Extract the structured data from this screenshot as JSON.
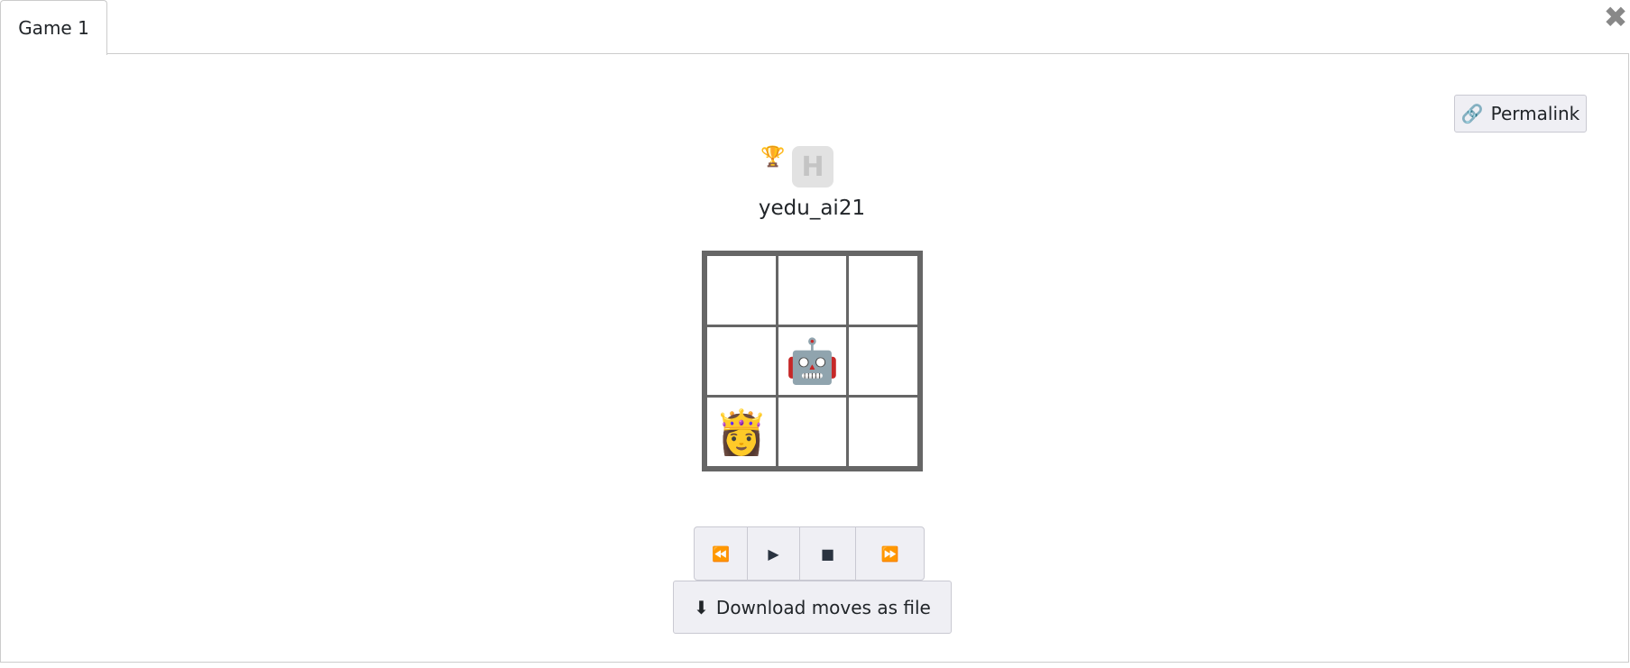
{
  "tabs": [
    {
      "label": "Game 1",
      "active": true
    }
  ],
  "close_icon": "close-icon",
  "permalink": {
    "label": "Permalink",
    "icon": "link-icon"
  },
  "player": {
    "name": "yedu_ai21",
    "badges": [
      "trophy-icon",
      "h-icon"
    ],
    "h_letter": "H"
  },
  "board": {
    "rows": 3,
    "cols": 3,
    "cells": [
      [
        "",
        "",
        ""
      ],
      [
        "",
        "robot",
        ""
      ],
      [
        "queen",
        "",
        ""
      ]
    ],
    "glyphs": {
      "robot": "🤖",
      "queen": "👸"
    }
  },
  "controls": {
    "rewind": "⏪",
    "play": "▶",
    "stop": "■",
    "fast_forward": "⏩"
  },
  "download": {
    "label": "Download moves as file",
    "icon": "download-icon"
  }
}
